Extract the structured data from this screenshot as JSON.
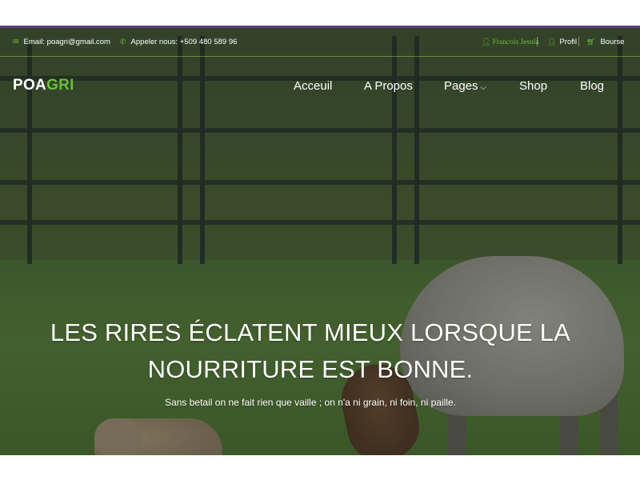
{
  "info_bar": {
    "email_label": "Email: poagri@gmail.com",
    "phone_label": "Appeler nous: +509 480 589 96",
    "user_name": "Francois Jesula",
    "profile_label": "Profil",
    "cart_label": "Bourse"
  },
  "icons": {
    "email": "envelope-icon",
    "phone": "phone-icon",
    "user": "user-icon",
    "profile": "user-icon",
    "cart": "cart-icon"
  },
  "brand": {
    "logo_part1": "POA",
    "logo_part2": "GRI",
    "accent_color": "#6abf3a"
  },
  "nav": {
    "items": [
      {
        "label": "Acceuil"
      },
      {
        "label": "A Propos"
      },
      {
        "label": "Pages"
      },
      {
        "label": "Shop"
      },
      {
        "label": "Blog"
      }
    ]
  },
  "hero": {
    "headline_line1": "LES RIRES ÉCLATENT MIEUX LORSQUE LA",
    "headline_line2": "NOURRITURE EST BONNE.",
    "subtitle": "Sans betail on ne fait rien que vaille ; on n'a ni grain, ni foin, ni paille."
  }
}
